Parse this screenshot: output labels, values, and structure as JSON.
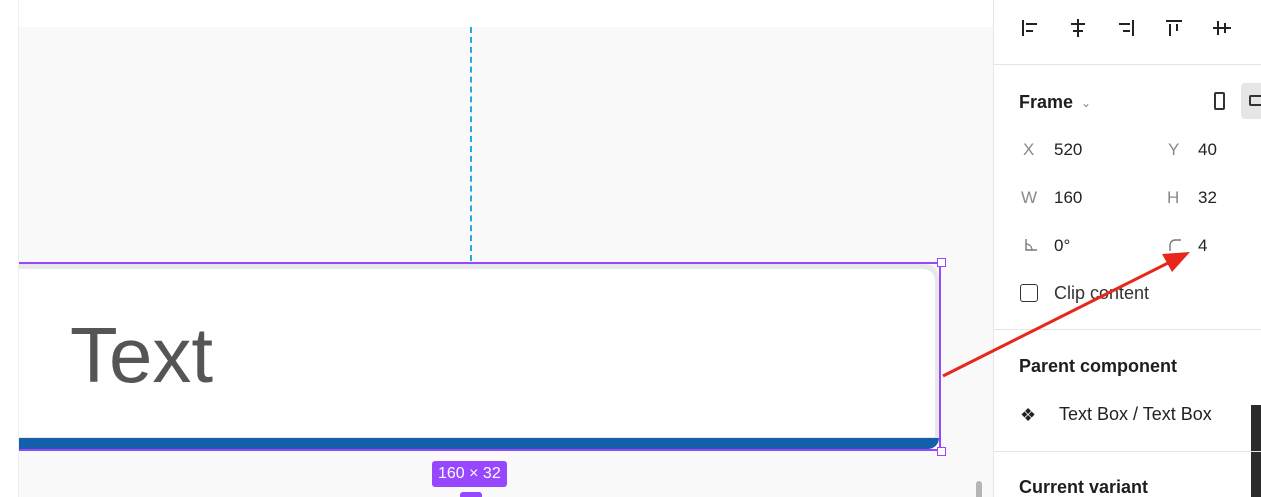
{
  "canvas": {
    "frame_text": "Text",
    "size_badge": "160 × 32",
    "colors": {
      "selection": "#9747ff",
      "guide": "#29a8e0",
      "underline": "#145eac",
      "arrow": "#e8261c"
    }
  },
  "panel": {
    "align_icons": [
      "align-left-icon",
      "align-horizontal-center-icon",
      "align-right-icon",
      "align-top-icon",
      "align-vertical-center-icon"
    ],
    "frame": {
      "title": "Frame",
      "x_label": "X",
      "x_value": "520",
      "y_label": "Y",
      "y_value": "40",
      "w_label": "W",
      "w_value": "160",
      "h_label": "H",
      "h_value": "32",
      "rotation_value": "0°",
      "radius_value": "4",
      "clip_content_label": "Clip content",
      "clip_content_checked": false
    },
    "parent_component": {
      "title": "Parent component",
      "name": "Text Box / Text Box"
    },
    "current_variant": {
      "title": "Current variant"
    }
  }
}
